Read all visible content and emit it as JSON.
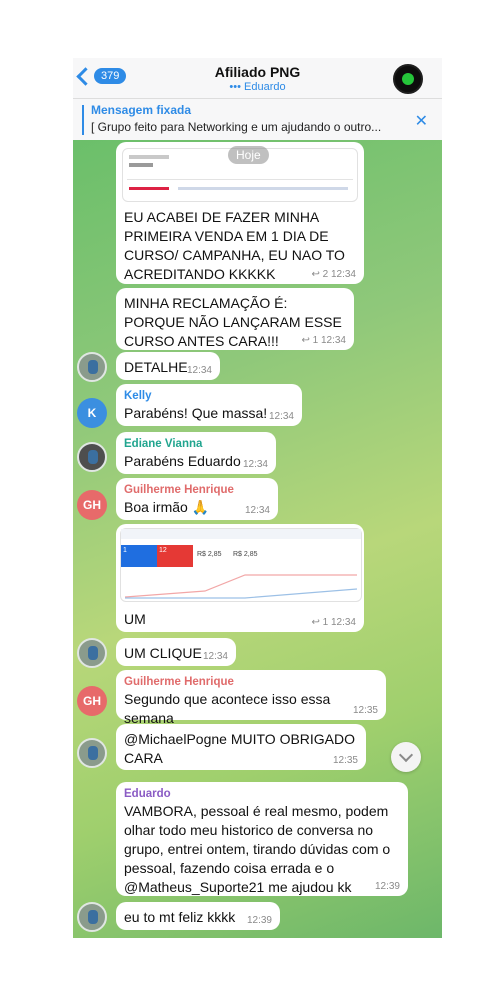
{
  "header": {
    "back_count": "379",
    "title": "Afiliado PNG",
    "subtitle": "••• Eduardo"
  },
  "pinned": {
    "label": "Mensagem fixada",
    "text": "[ Grupo feito para Networking e um ajudando o outro..."
  },
  "chat": {
    "date_label": "Hoje",
    "messages": [
      {
        "text": "EU ACABEI DE FAZER MINHA PRIMEIRA VENDA EM 1 DIA DE CURSO/ CAMPANHA, EU NAO TO ACREDITANDO KKKKK",
        "meta": "↩ 2  12:34"
      },
      {
        "text": "MINHA RECLAMAÇÃO É: PORQUE NÃO LANÇARAM ESSE CURSO ANTES CARA!!!",
        "meta": "↩ 1  12:34"
      },
      {
        "text": "DETALHE",
        "meta": "12:34"
      },
      {
        "sender": "Kelly",
        "sender_color": "#2e8be6",
        "text": "Parabéns! Que massa!",
        "meta": "12:34"
      },
      {
        "sender": "Ediane Vianna",
        "sender_color": "#21a58f",
        "text": "Parabéns Eduardo",
        "meta": "12:34"
      },
      {
        "sender": "Guilherme Henrique",
        "sender_color": "#e06b6b",
        "text": "Boa irmão 🙏",
        "meta": "12:34"
      },
      {
        "text": "UM",
        "meta": "↩ 1  12:34",
        "shot_values": {
          "a": "1",
          "b": "12",
          "c": "R$ 2,85",
          "d": "R$ 2,85"
        }
      },
      {
        "text": "UM CLIQUE",
        "meta": "12:34"
      },
      {
        "sender": "Guilherme Henrique",
        "sender_color": "#e06b6b",
        "text": "Segundo que acontece isso essa semana",
        "meta": "12:35"
      },
      {
        "text": "@MichaelPogne  MUITO OBRIGADO CARA",
        "meta": "12:35"
      },
      {
        "sender": "Eduardo",
        "sender_color": "#8a5bc4",
        "text": "VAMBORA, pessoal é real mesmo, podem olhar todo meu historico de conversa no grupo, entrei ontem, tirando dúvidas com o pessoal, fazendo coisa errada e o @Matheus_Suporte21  me ajudou kk",
        "meta": "12:39"
      },
      {
        "text": "eu to mt feliz kkkk",
        "meta": "12:39"
      }
    ],
    "avatars": {
      "kelly": "K",
      "guilherme": "GH"
    },
    "colors": {
      "accent": "#2e8be6",
      "kelly": "#3b8fe0",
      "guilherme": "#e76a6a"
    }
  }
}
